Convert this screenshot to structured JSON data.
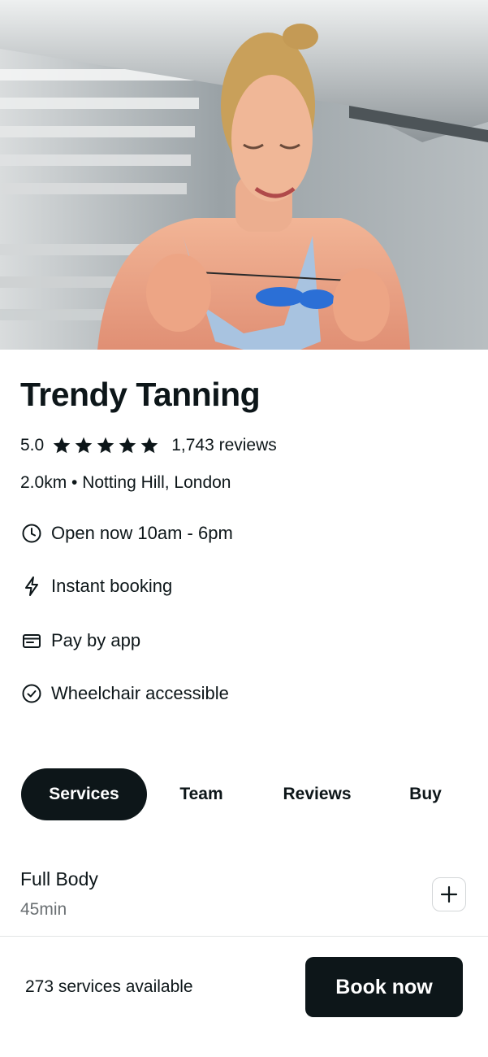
{
  "hero": {
    "image": "salon-photo"
  },
  "business": {
    "name": "Trendy Tanning",
    "rating": "5.0",
    "stars": 5,
    "reviews": "1,743 reviews",
    "location": "2.0km • Notting Hill, London"
  },
  "amenities": {
    "hours": {
      "icon": "clock-icon",
      "label": "Open now 10am - 6pm"
    },
    "instant": {
      "icon": "lightning-icon",
      "label": "Instant booking"
    },
    "pay": {
      "icon": "card-icon",
      "label": "Pay by app"
    },
    "access": {
      "icon": "check-circle-icon",
      "label": "Wheelchair accessible"
    }
  },
  "tabs": {
    "services": "Services",
    "team": "Team",
    "reviews": "Reviews",
    "buy": "Buy",
    "active": "Services"
  },
  "service": {
    "name": "Full Body",
    "duration": "45min"
  },
  "footer": {
    "count": "273 services available",
    "book_label": "Book now"
  },
  "colors": {
    "primary": "#0d1619",
    "muted": "#6b7073",
    "border": "#d3d6d8"
  }
}
